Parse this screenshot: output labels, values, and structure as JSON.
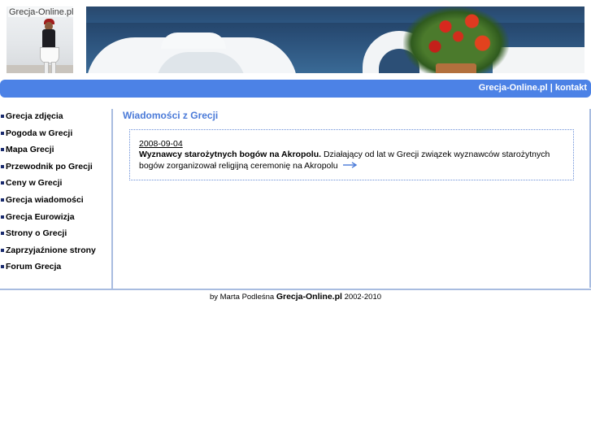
{
  "header": {
    "logo_text": "Grecja-Online.pl"
  },
  "navbar": {
    "home_link": "Grecja-Online.pl",
    "separator": "|",
    "contact_link": "kontakt",
    "color": "#4c82e6"
  },
  "sidebar": {
    "items": [
      {
        "label": "Grecja zdjęcia"
      },
      {
        "label": "Pogoda w Grecji"
      },
      {
        "label": "Mapa Grecji"
      },
      {
        "label": "Przewodnik po Grecji"
      },
      {
        "label": "Ceny w Grecji"
      },
      {
        "label": "Grecja wiadomości"
      },
      {
        "label": "Grecja Eurowizja"
      },
      {
        "label": "Strony o Grecji"
      },
      {
        "label": "Zaprzyjaźnione strony"
      },
      {
        "label": "Forum Grecja"
      }
    ]
  },
  "main": {
    "title": "Wiadomości z Grecji",
    "title_color": "#4a7ad8",
    "news": {
      "date": "2008-09-04",
      "headline": "Wyznawcy starożytnych bogów na Akropolu.",
      "body": "Działający od lat w Grecji związek wyznawców starożytnych bogów zorganizował religijną ceremonię na Akropolu",
      "more_icon": "arrow-right-icon"
    }
  },
  "footer": {
    "prefix": "by Marta Podleśna",
    "site": "Grecja-Online.pl",
    "years": "2002-2010"
  }
}
